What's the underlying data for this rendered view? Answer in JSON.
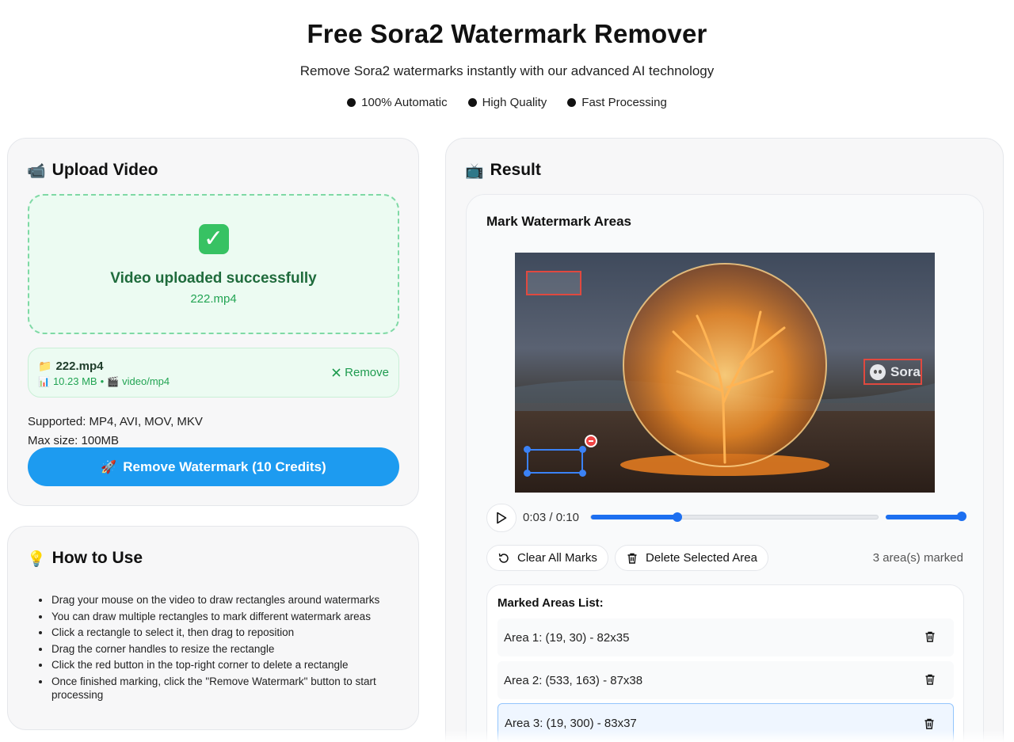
{
  "header": {
    "title": "Free Sora2 Watermark Remover",
    "subtitle": "Remove Sora2 watermarks instantly with our advanced AI technology",
    "features": [
      "100% Automatic",
      "High Quality",
      "Fast Processing"
    ]
  },
  "upload": {
    "icon": "video-camera-icon",
    "title": "Upload Video",
    "success_title": "Video uploaded successfully",
    "file_name": "222.mp4",
    "file_card": {
      "name": "222.mp4",
      "size": "10.23 MB",
      "separator": "•",
      "type": "video/mp4",
      "remove_label": "Remove"
    },
    "supported": "Supported: MP4, AVI, MOV, MKV",
    "max_size": "Max size: 100MB",
    "action_label": "Remove Watermark (10 Credits)"
  },
  "howto": {
    "icon": "lightbulb-icon",
    "title": "How to Use",
    "steps": [
      "Drag your mouse on the video to draw rectangles around watermarks",
      "You can draw multiple rectangles to mark different watermark areas",
      "Click a rectangle to select it, then drag to reposition",
      "Drag the corner handles to resize the rectangle",
      "Click the red button in the top-right corner to delete a rectangle",
      "Once finished marking, click the \"Remove Watermark\" button to start processing"
    ]
  },
  "result": {
    "icon": "tv-icon",
    "title": "Result",
    "card_title": "Mark Watermark Areas",
    "watermark_text": "Sora",
    "player": {
      "current_time": "0:03",
      "separator": "/",
      "duration": "0:10",
      "progress": 0.3,
      "volume": 1.0
    },
    "clear_label": "Clear All Marks",
    "delete_label": "Delete Selected Area",
    "marked_count": "3 area(s) marked",
    "areas_title": "Marked Areas List:",
    "areas": [
      {
        "label": "Area 1: (19, 30) - 82x35",
        "selected": false
      },
      {
        "label": "Area 2: (533, 163) - 87x38",
        "selected": false
      },
      {
        "label": "Area 3: (19, 300) - 83x37",
        "selected": true
      }
    ]
  },
  "colors": {
    "accent": "#1d9bf0",
    "success": "#22a453",
    "danger": "#e0493f",
    "selected": "#3b82f6"
  }
}
